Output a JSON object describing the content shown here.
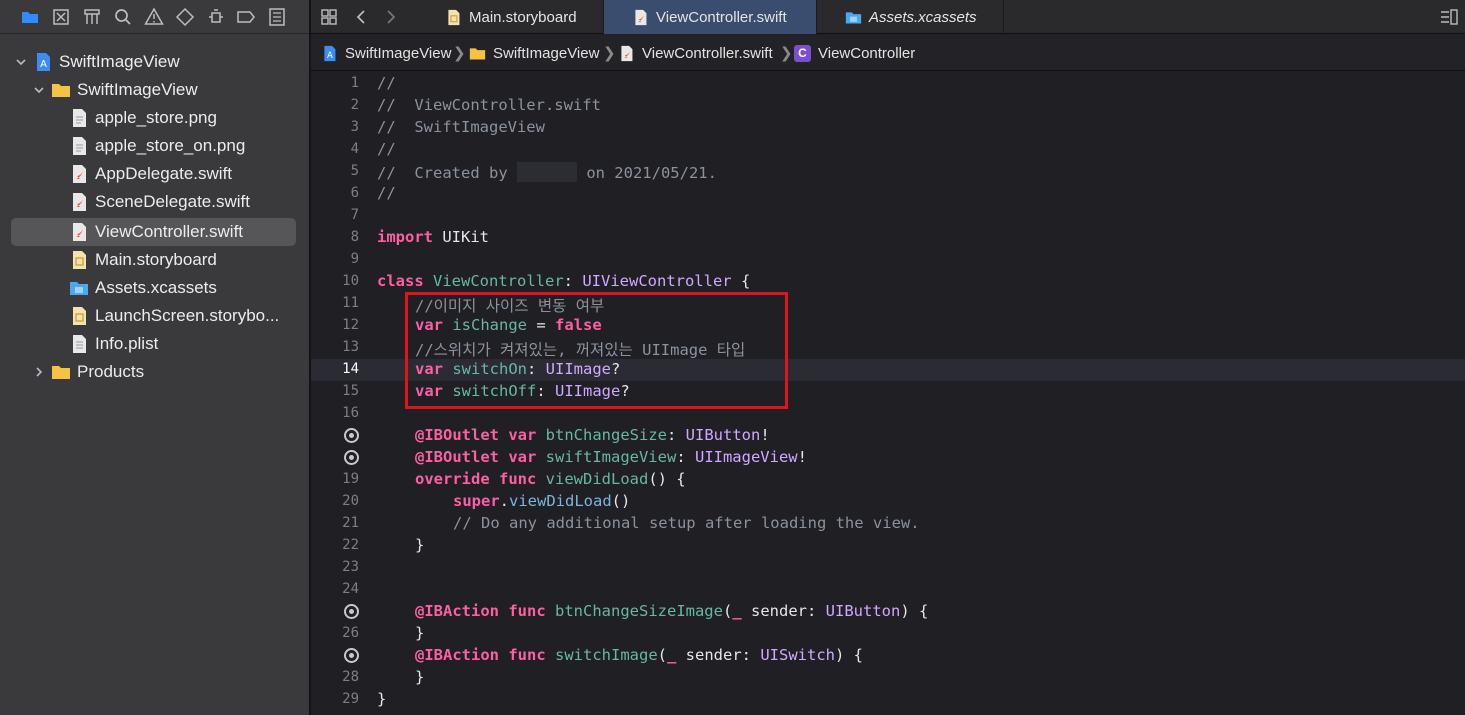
{
  "navigator": {
    "toolbar_icons": [
      "folder-icon",
      "source-control-icon",
      "hierarchy-icon",
      "search-icon",
      "warning-icon",
      "test-icon",
      "debug-icon",
      "breakpoint-icon",
      "report-icon"
    ],
    "items": [
      {
        "label": "SwiftImageView",
        "icon": "project-icon",
        "expanded": true
      },
      {
        "label": "SwiftImageView",
        "icon": "folder-icon",
        "expanded": true
      },
      {
        "label": "apple_store.png",
        "icon": "file-icon"
      },
      {
        "label": "apple_store_on.png",
        "icon": "file-icon"
      },
      {
        "label": "AppDelegate.swift",
        "icon": "swift-file-icon"
      },
      {
        "label": "SceneDelegate.swift",
        "icon": "swift-file-icon"
      },
      {
        "label": "ViewController.swift",
        "icon": "swift-file-icon",
        "selected": true
      },
      {
        "label": "Main.storyboard",
        "icon": "storyboard-icon"
      },
      {
        "label": "Assets.xcassets",
        "icon": "assets-icon"
      },
      {
        "label": "LaunchScreen.storybo...",
        "icon": "storyboard-icon"
      },
      {
        "label": "Info.plist",
        "icon": "plist-icon"
      },
      {
        "label": "Products",
        "icon": "folder-icon",
        "expanded": false
      }
    ]
  },
  "tabs": [
    {
      "label": "Main.storyboard",
      "active": false
    },
    {
      "label": "ViewController.swift",
      "active": true
    },
    {
      "label": "Assets.xcassets",
      "active": false
    }
  ],
  "breadcrumb": [
    "SwiftImageView",
    "SwiftImageView",
    "ViewController.swift",
    "ViewController"
  ],
  "class_badge": "C",
  "code": {
    "l1": "//",
    "l2": "//  ViewController.swift",
    "l3": "//  SwiftImageView",
    "l4": "//",
    "l5a": "//  Created by ",
    "l5b": " on 2021/05/21.",
    "l6": "//",
    "l8_kw": "import",
    "l8_mod": " UIKit",
    "l10_kw": "class",
    "l10_name": " ViewController",
    "l10_sep": ": ",
    "l10_super": "UIViewController",
    "l10_end": " {",
    "l11": "//이미지 사이즈 변동 여부",
    "l12_kw": "var",
    "l12_name": " isChange",
    "l12_eq": " = ",
    "l12_val": "false",
    "l13": "//스위치가 켜져있는, 꺼져있는 UIImage 타입",
    "l14_kw": "var",
    "l14_name": " switchOn",
    "l14_sep": ": ",
    "l14_type": "UIImage",
    "l14_q": "?",
    "l15_kw": "var",
    "l15_name": " switchOff",
    "l15_sep": ": ",
    "l15_type": "UIImage",
    "l15_q": "?",
    "l17_attr": "@IBOutlet",
    "l17_kw": " var",
    "l17_name": " btnChangeSize",
    "l17_sep": ": ",
    "l17_type": "UIButton",
    "l17_q": "!",
    "l18_attr": "@IBOutlet",
    "l18_kw": " var",
    "l18_name": " swiftImageView",
    "l18_sep": ": ",
    "l18_type": "UIImageView",
    "l18_q": "!",
    "l19_kw": "override func",
    "l19_name": " viewDidLoad",
    "l19_end": "() {",
    "l20_kw": "super",
    "l20_dot": ".",
    "l20_call": "viewDidLoad",
    "l20_end": "()",
    "l21": "// Do any additional setup after loading the view.",
    "l22": "}",
    "l25_attr": "@IBAction",
    "l25_kw": " func",
    "l25_name": " btnChangeSizeImage",
    "l25_open": "(",
    "l25_us": "_",
    "l25_param": " sender: ",
    "l25_type": "UIButton",
    "l25_end": ") {",
    "l26": "}",
    "l27_attr": "@IBAction",
    "l27_kw": " func",
    "l27_name": " switchImage",
    "l27_open": "(",
    "l27_us": "_",
    "l27_param": " sender: ",
    "l27_type": "UISwitch",
    "l27_end": ") {",
    "l28": "}",
    "l29": "}"
  },
  "line_numbers": [
    "1",
    "2",
    "3",
    "4",
    "5",
    "6",
    "7",
    "8",
    "9",
    "10",
    "11",
    "12",
    "13",
    "14",
    "15",
    "16",
    "",
    "",
    "19",
    "20",
    "21",
    "22",
    "23",
    "24",
    "",
    "26",
    "",
    "28",
    "29"
  ],
  "current_line": "14",
  "colors": {
    "keyword": "#fc5fa3",
    "comment": "#8c929c",
    "type": "#d0a8ff",
    "declaration": "#67b7a4",
    "call": "#7ab5de",
    "highlight": "#e2141b"
  }
}
